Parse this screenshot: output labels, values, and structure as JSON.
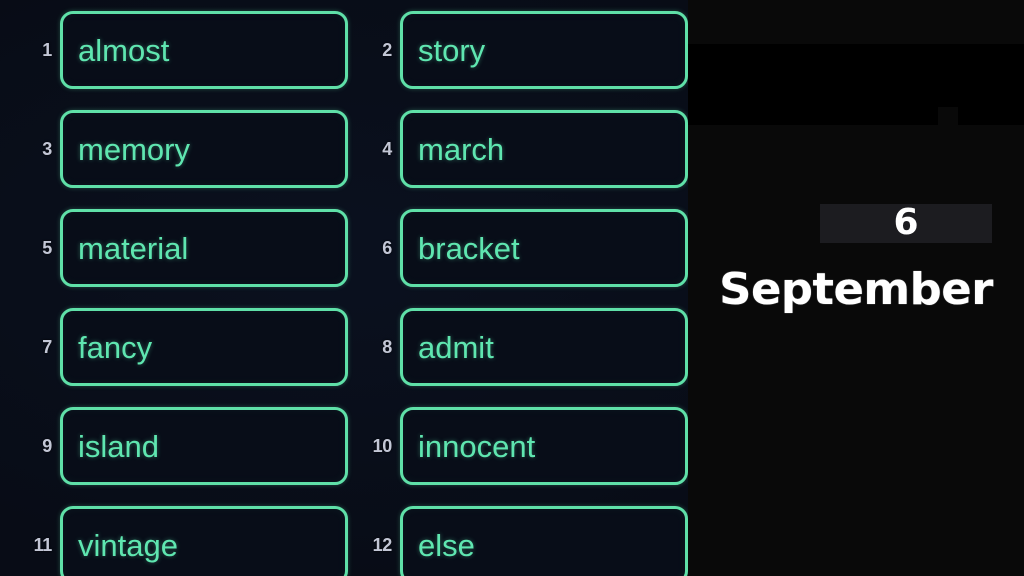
{
  "word_panel": {
    "columns": 2,
    "accent_color": "#5fe0a8",
    "text_color": "#5fe6b0",
    "number_color": "#c3c7d6",
    "background_color": "#080c16",
    "items": [
      {
        "number": "1",
        "word": "almost"
      },
      {
        "number": "2",
        "word": "story"
      },
      {
        "number": "3",
        "word": "memory"
      },
      {
        "number": "4",
        "word": "march"
      },
      {
        "number": "5",
        "word": "material"
      },
      {
        "number": "6",
        "word": "bracket"
      },
      {
        "number": "7",
        "word": "fancy"
      },
      {
        "number": "8",
        "word": "admit"
      },
      {
        "number": "9",
        "word": "island"
      },
      {
        "number": "10",
        "word": "innocent"
      },
      {
        "number": "11",
        "word": "vintage"
      },
      {
        "number": "12",
        "word": "else"
      }
    ]
  },
  "date_panel": {
    "background_color": "#090909",
    "chip_color": "#1c1c20",
    "text_color": "#ffffff",
    "day": "6",
    "month": "September"
  }
}
